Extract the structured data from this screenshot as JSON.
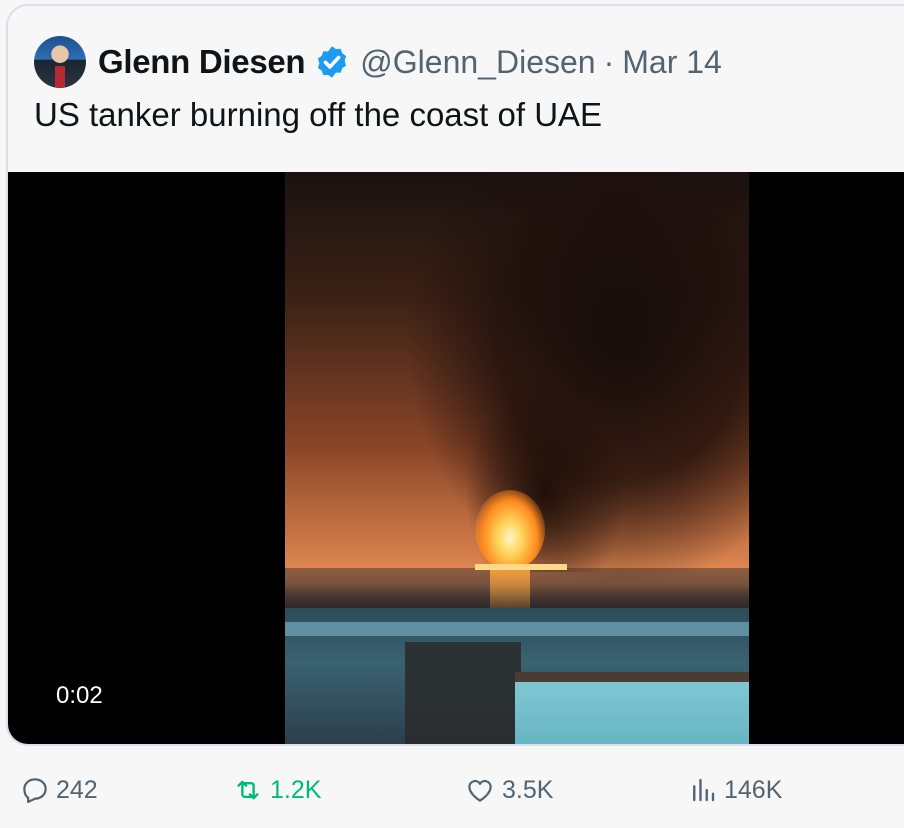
{
  "tweet": {
    "author_name": "Glenn Diesen",
    "author_handle": "@Glenn_Diesen",
    "separator": "·",
    "date": "Mar 14",
    "text": "US tanker burning off the coast of UAE",
    "verified_icon": "verified-badge-icon",
    "verified_color": "#1d9bf0"
  },
  "media": {
    "type": "video",
    "timestamp": "0:02"
  },
  "actions": {
    "replies": "242",
    "retweets": "1.2K",
    "likes": "3.5K",
    "views": "146K",
    "retweet_color": "#00ba7c",
    "icons": [
      "reply-icon",
      "retweet-icon",
      "like-icon",
      "views-icon"
    ]
  }
}
